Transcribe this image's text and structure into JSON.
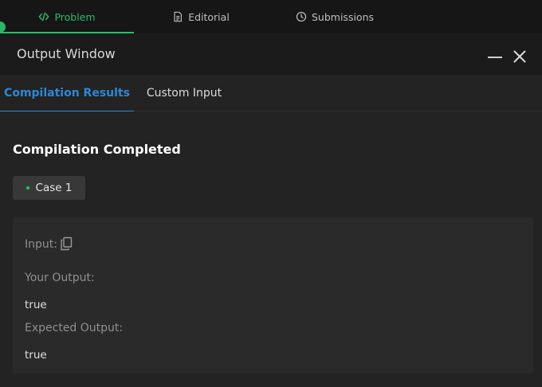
{
  "top_tabs": [
    {
      "label": "Problem",
      "icon": "code-icon"
    },
    {
      "label": "Editorial",
      "icon": "document-icon"
    },
    {
      "label": "Submissions",
      "icon": "clock-icon"
    }
  ],
  "window": {
    "title": "Output Window",
    "minimize_icon": "minimize-icon",
    "close_icon": "close-icon"
  },
  "output_tabs": [
    {
      "label": "Compilation Results",
      "active": true
    },
    {
      "label": "Custom Input",
      "active": false
    }
  ],
  "status": "Compilation Completed",
  "case_button": "Case 1",
  "result": {
    "input_label": "Input:",
    "your_output_label": "Your Output:",
    "your_output_value": "true",
    "expected_output_label": "Expected Output:",
    "expected_output_value": "true"
  },
  "colors": {
    "accent_green": "#2dbb6a",
    "accent_blue": "#2f86d6",
    "background": "#1f1f1f"
  }
}
